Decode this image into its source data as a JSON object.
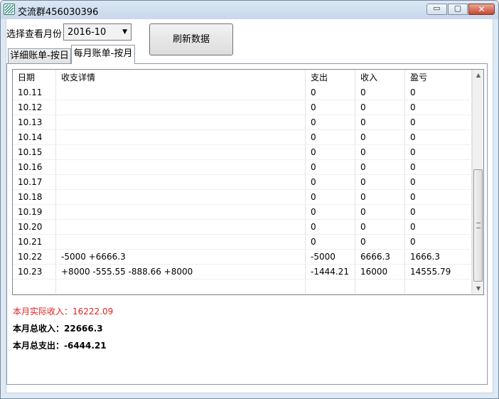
{
  "window": {
    "title": "交流群456030396",
    "controls": {
      "minimize": "▭",
      "maximize": "▢",
      "close": "✕"
    }
  },
  "toolbar": {
    "month_label": "选择查看月份",
    "month_value": "2016-10",
    "refresh_label": "刷新数据"
  },
  "tabs": [
    {
      "label": "详细账单-按日",
      "active": false
    },
    {
      "label": "每月账单-按月",
      "active": true
    }
  ],
  "table": {
    "columns": [
      "日期",
      "收支详情",
      "支出",
      "收入",
      "盈亏"
    ],
    "rows": [
      [
        "10.11",
        "",
        "0",
        "0",
        "0"
      ],
      [
        "10.12",
        "",
        "0",
        "0",
        "0"
      ],
      [
        "10.13",
        "",
        "0",
        "0",
        "0"
      ],
      [
        "10.14",
        "",
        "0",
        "0",
        "0"
      ],
      [
        "10.15",
        "",
        "0",
        "0",
        "0"
      ],
      [
        "10.16",
        "",
        "0",
        "0",
        "0"
      ],
      [
        "10.17",
        "",
        "0",
        "0",
        "0"
      ],
      [
        "10.18",
        "",
        "0",
        "0",
        "0"
      ],
      [
        "10.19",
        "",
        "0",
        "0",
        "0"
      ],
      [
        "10.20",
        "",
        "0",
        "0",
        "0"
      ],
      [
        "10.21",
        "",
        "0",
        "0",
        "0"
      ],
      [
        "10.22",
        "-5000 +6666.3",
        "-5000",
        "6666.3",
        "1666.3"
      ],
      [
        "10.23",
        "+8000 -555.55 -888.66 +8000",
        "-1444.21",
        "16000",
        "14555.79"
      ],
      [
        "",
        "",
        "",
        "",
        ""
      ]
    ]
  },
  "summary": {
    "actual_income": "本月实际收入：16222.09",
    "total_income": "本月总收入：22666.3",
    "total_expense": "本月总支出：-6444.21"
  },
  "colors": {
    "actual_income_text": "#e02020",
    "window_frame": "#dde9f5"
  }
}
